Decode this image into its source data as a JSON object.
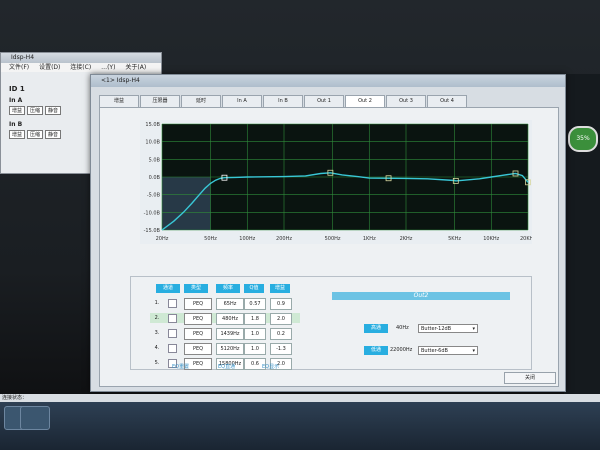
{
  "back_window": {
    "title": "Idsp-H4",
    "menus": [
      "文件(F)",
      "设置(D)",
      "连接(C)",
      "…(Y)",
      "关于(A)"
    ],
    "id_label": "ID 1",
    "in_a": "In A",
    "in_b": "In B",
    "mini_buttons": [
      "增益",
      "压缩",
      "静音"
    ]
  },
  "topbar_title": "<1> Idsp-H4",
  "dialog": {
    "title": "<1> Idsp-H4",
    "tabs": [
      "增益",
      "压限器",
      "延时",
      "In A",
      "In B",
      "Out 1",
      "Out 2",
      "Out 3",
      "Out 4"
    ],
    "active_tab": "Out 2"
  },
  "chart_data": {
    "type": "line",
    "title": "",
    "xlabel": "",
    "ylabel": "",
    "x_ticks": [
      "20Hz",
      "50Hz",
      "100Hz",
      "200Hz",
      "500Hz",
      "1KHz",
      "2KHz",
      "5KHz",
      "10KHz",
      "20KHz"
    ],
    "y_ticks": [
      "15.0B",
      "10.0B",
      "5.0B",
      "0.0B",
      "-5.0B",
      "-10.0B",
      "-15.0B"
    ],
    "ylim": [
      -15,
      15
    ],
    "series": [
      {
        "values_x": [
          20,
          25,
          30,
          35,
          40,
          45,
          50,
          55,
          60,
          65,
          80,
          100,
          200,
          300,
          400,
          480,
          600,
          800,
          1000,
          2000,
          3000,
          5000,
          5120,
          8000,
          10000,
          12000,
          15000,
          15800,
          18000,
          20000
        ],
        "values_y": [
          -15,
          -12.5,
          -10,
          -7.5,
          -5.2,
          -3.2,
          -1.8,
          -0.9,
          -0.4,
          -0.2,
          -0.1,
          0.0,
          0.1,
          0.3,
          1.0,
          1.2,
          0.6,
          0.1,
          -0.3,
          -0.4,
          -0.5,
          -1.0,
          -1.1,
          -0.5,
          0.0,
          0.4,
          0.9,
          1.0,
          0.4,
          -1.5
        ]
      }
    ],
    "markers_x": [
      65,
      480,
      1439,
      5120,
      15800,
      20000
    ]
  },
  "eq_table": {
    "headers": [
      "通道",
      "类型",
      "频率",
      "Q值",
      "增益"
    ],
    "rows": [
      {
        "idx": "1.",
        "type": "PEQ",
        "freq": "65Hz",
        "q": "0.57",
        "gain": "0.9"
      },
      {
        "idx": "2.",
        "type": "PEQ",
        "freq": "480Hz",
        "q": "1.8",
        "gain": "2.0"
      },
      {
        "idx": "3.",
        "type": "PEQ",
        "freq": "1439Hz",
        "q": "1.0",
        "gain": "0.2"
      },
      {
        "idx": "4.",
        "type": "PEQ",
        "freq": "5120Hz",
        "q": "1.0",
        "gain": "-1.3"
      },
      {
        "idx": "5.",
        "type": "PEQ",
        "freq": "15800Hz",
        "q": "0.6",
        "gain": "2.0"
      }
    ],
    "buttons": [
      "EQ重置",
      "EQ直通",
      "EQ显示"
    ]
  },
  "output": {
    "header": "Out2",
    "highpass": {
      "label": "高通",
      "freq": "40Hz",
      "filter": "Butter-12dB"
    },
    "lowpass": {
      "label": "低通",
      "freq": "22000Hz",
      "filter": "Butter-6dB"
    }
  },
  "close_button": "关闭",
  "status_text": "连接状态：",
  "badge": "35%"
}
